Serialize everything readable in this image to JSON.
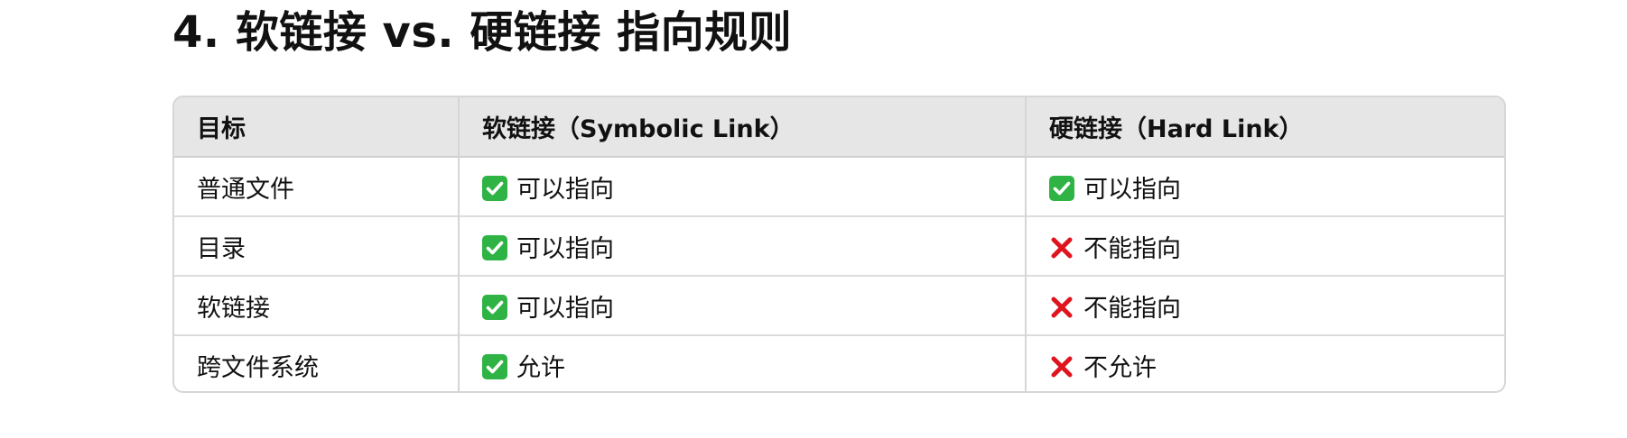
{
  "heading": "4. 软链接 vs. 硬链接 指向规则",
  "table": {
    "headers": [
      "目标",
      "软链接（Symbolic Link）",
      "硬链接（Hard Link）"
    ],
    "rows": [
      {
        "target": "普通文件",
        "soft": {
          "icon": "check-mark-icon",
          "text": "可以指向"
        },
        "hard": {
          "icon": "check-mark-icon",
          "text": "可以指向"
        }
      },
      {
        "target": "目录",
        "soft": {
          "icon": "check-mark-icon",
          "text": "可以指向"
        },
        "hard": {
          "icon": "cross-mark-icon",
          "text": "不能指向"
        }
      },
      {
        "target": "软链接",
        "soft": {
          "icon": "check-mark-icon",
          "text": "可以指向"
        },
        "hard": {
          "icon": "cross-mark-icon",
          "text": "不能指向"
        }
      },
      {
        "target": "跨文件系统",
        "soft": {
          "icon": "check-mark-icon",
          "text": "允许"
        },
        "hard": {
          "icon": "cross-mark-icon",
          "text": "不允许"
        }
      }
    ]
  },
  "colors": {
    "check": "#2fb344",
    "cross": "#e0141e",
    "header_bg": "#e6e6e6",
    "border": "#d6d6d6"
  }
}
